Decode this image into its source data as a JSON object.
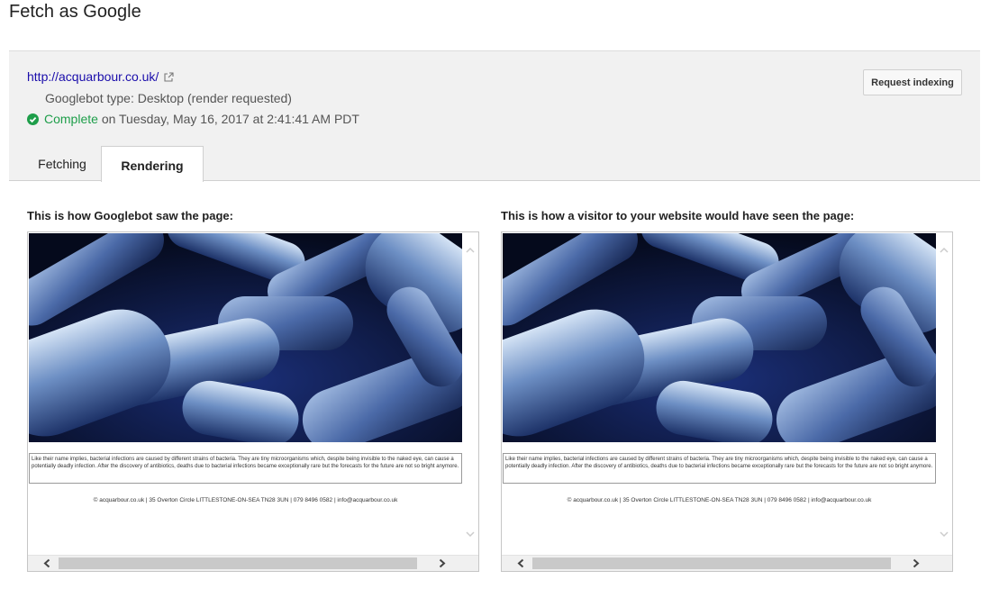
{
  "page": {
    "title": "Fetch as Google"
  },
  "fetch": {
    "url": "http://acquarbour.co.uk/",
    "bot_type": "Googlebot type: Desktop (render requested)",
    "status": "Complete",
    "timestamp": "on Tuesday, May 16, 2017 at 2:41:41 AM PDT",
    "request_indexing_label": "Request indexing"
  },
  "tabs": [
    {
      "label": "Fetching",
      "active": false
    },
    {
      "label": "Rendering",
      "active": true
    }
  ],
  "panels": {
    "googlebot": {
      "caption": "This is how Googlebot saw the page:",
      "body_text": "Like their name implies, bacterial infections are caused by different strains of bacteria. They are tiny microorganisms which, despite being invisible to the naked eye, can cause a potentially deadly infection. After the discovery of antibiotics, deaths due to bacterial infections became exceptionally rare but the forecasts for the future are not so bright anymore.",
      "footer": "© acquarbour.co.uk | 35 Overton Circle LITTLESTONE-ON-SEA TN28 3UN | 079 8496 0582 | info@acquarbour.co.uk"
    },
    "visitor": {
      "caption": "This is how a visitor to your website would have seen the page:",
      "body_text": "Like their name implies, bacterial infections are caused by different strains of bacteria. They are tiny microorganisms which, despite being invisible to the naked eye, can cause a potentially deadly infection. After the discovery of antibiotics, deaths due to bacterial infections became exceptionally rare but the forecasts for the future are not so bright anymore.",
      "footer": "© acquarbour.co.uk | 35 Overton Circle LITTLESTONE-ON-SEA TN28 3UN | 079 8496 0582 | info@acquarbour.co.uk"
    }
  },
  "colors": {
    "link": "#1a0dab",
    "success": "#1e9e4a",
    "panel_bg": "#f1f1f1"
  },
  "icons": [
    "external-link-icon",
    "check-circle-icon",
    "scroll-up-icon",
    "scroll-down-icon",
    "scroll-left-icon",
    "scroll-right-icon"
  ]
}
